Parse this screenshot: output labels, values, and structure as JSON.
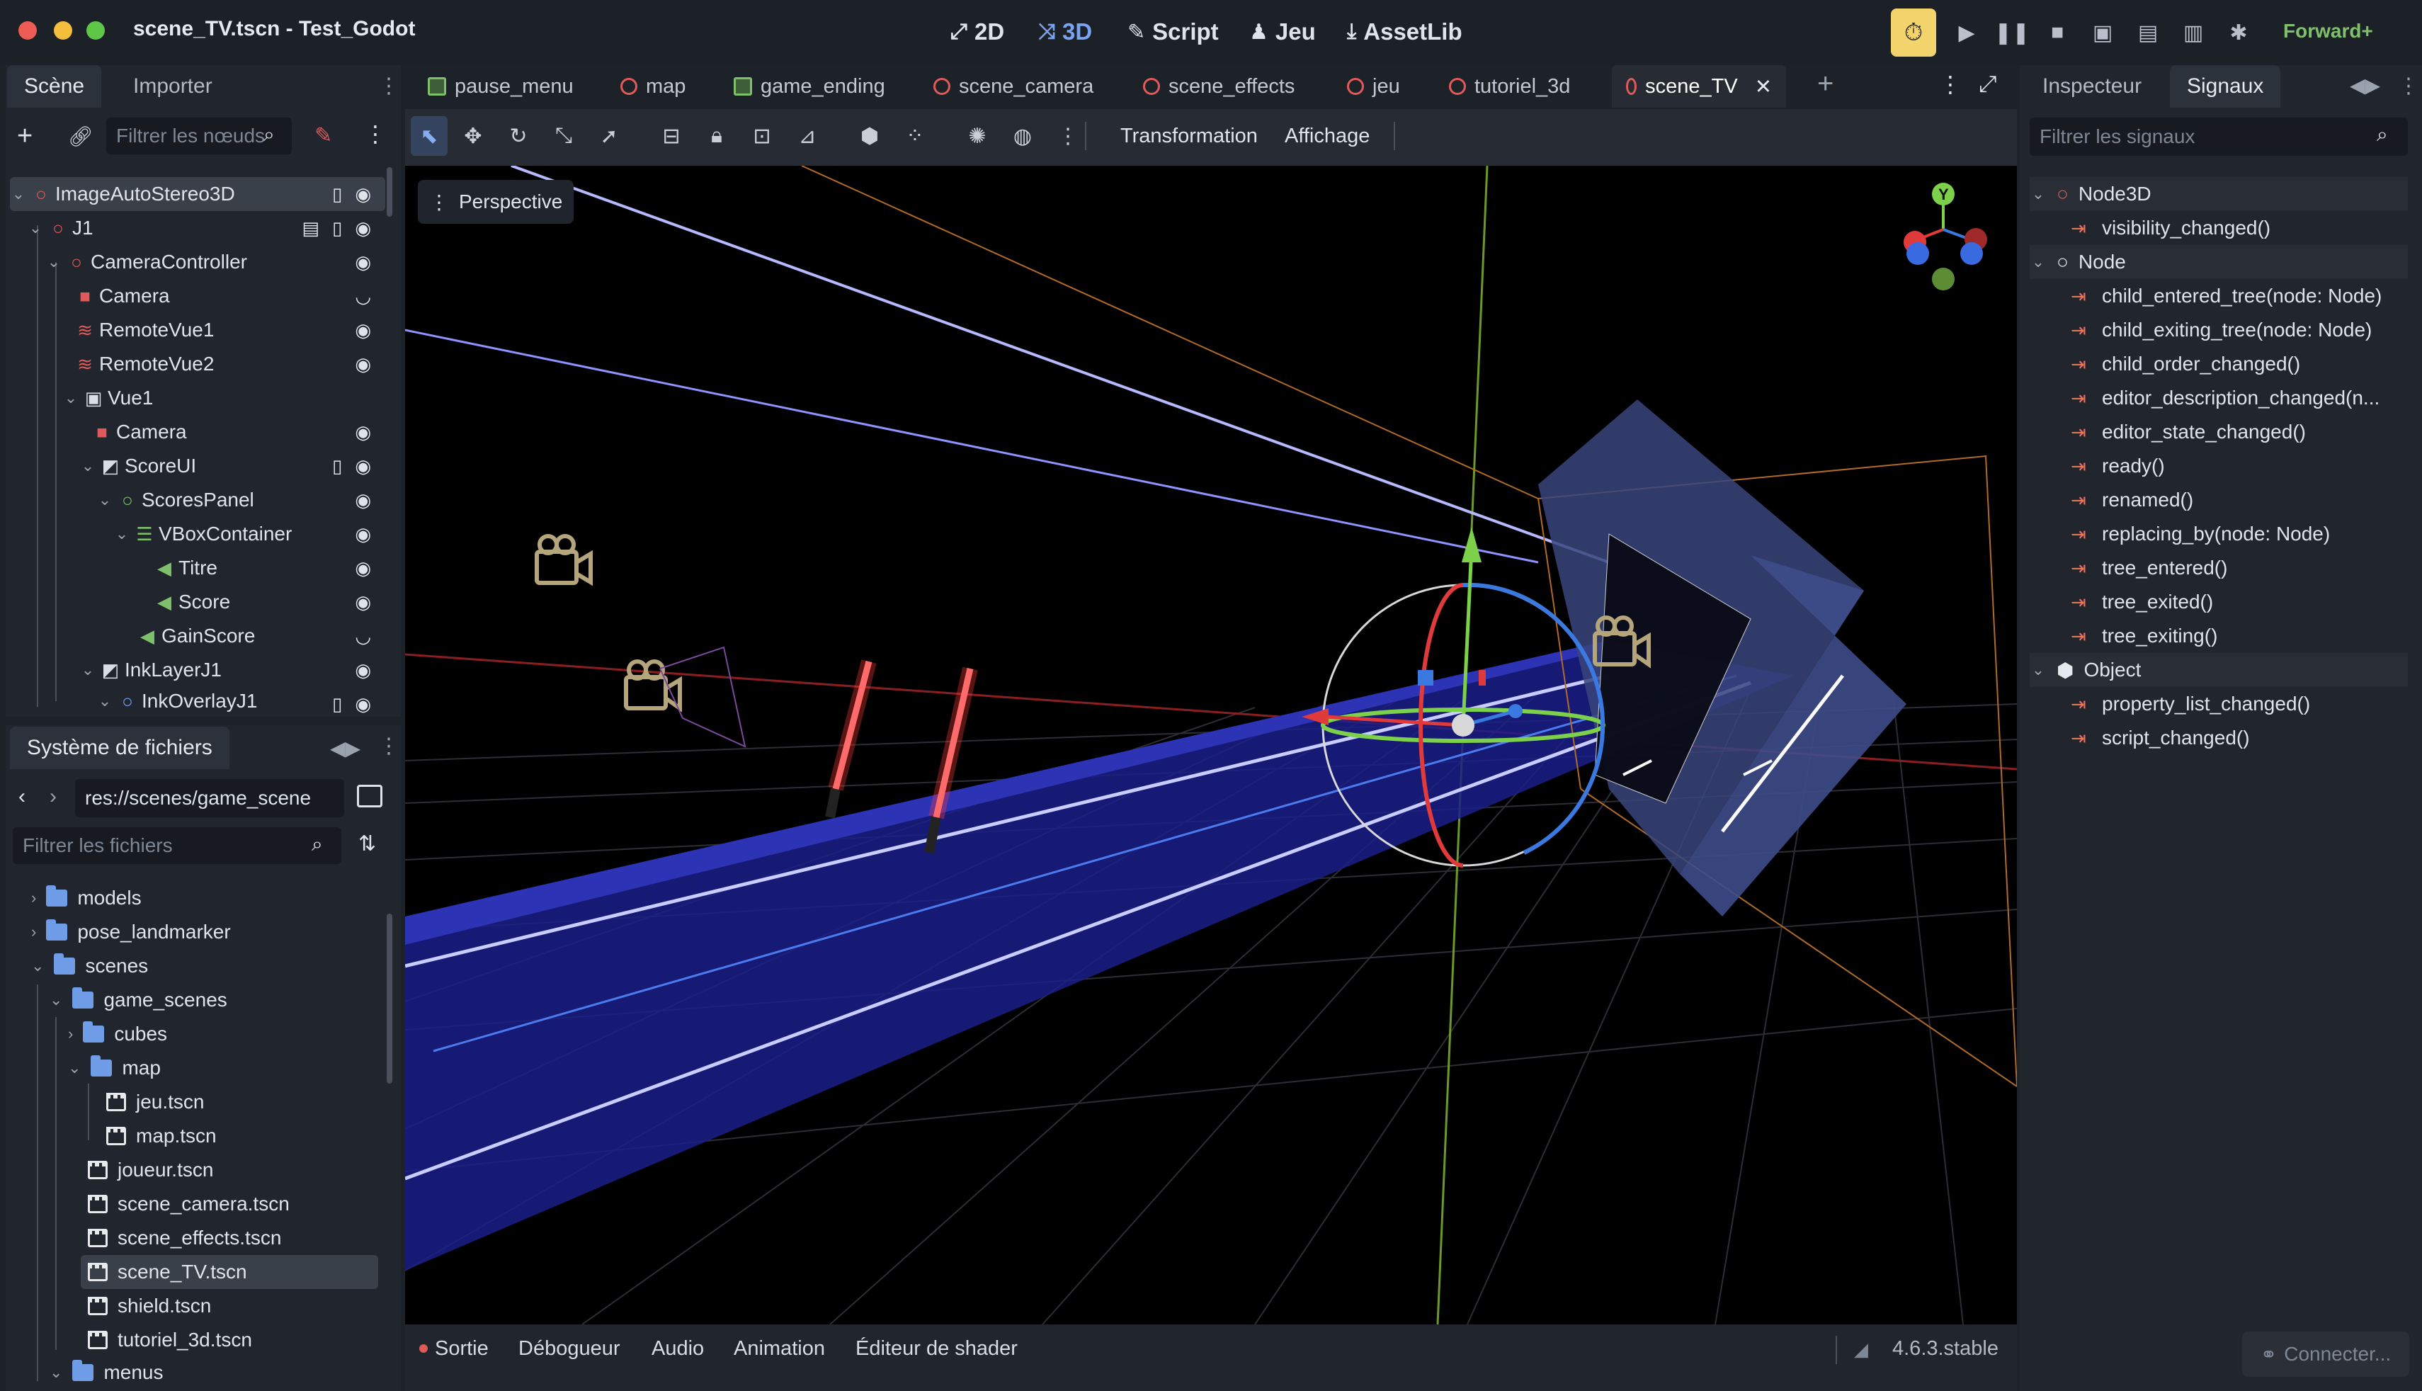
{
  "window": {
    "title": "scene_TV.tscn - Test_Godot"
  },
  "topbar": {
    "modes": [
      {
        "label": "2D",
        "icon": "2d-icon"
      },
      {
        "label": "3D",
        "icon": "3d-icon"
      },
      {
        "label": "Script",
        "icon": "script-icon"
      },
      {
        "label": "Jeu",
        "icon": "game-icon"
      },
      {
        "label": "AssetLib",
        "icon": "assetlib-icon"
      }
    ],
    "active_mode": "3D",
    "renderer": "Forward+"
  },
  "scene_dock": {
    "tabs": [
      "Scène",
      "Importer"
    ],
    "filter_placeholder": "Filtrer les nœuds",
    "nodes": [
      {
        "label": "ImageAutoStereo3D",
        "icon": "node3d-icon",
        "color": "#e05a5a",
        "selected": true
      },
      {
        "label": "J1",
        "icon": "node3d-icon",
        "color": "#e05a5a"
      },
      {
        "label": "CameraController",
        "icon": "node3d-icon",
        "color": "#e05a5a"
      },
      {
        "label": "Camera",
        "icon": "camera3d-icon",
        "color": "#e05a5a"
      },
      {
        "label": "RemoteVue1",
        "icon": "remote-icon",
        "color": "#e05a5a"
      },
      {
        "label": "RemoteVue2",
        "icon": "remote-icon",
        "color": "#e05a5a"
      },
      {
        "label": "Vue1",
        "icon": "subviewport-icon",
        "color": "#d8dde6"
      },
      {
        "label": "Camera",
        "icon": "camera3d-icon",
        "color": "#e05a5a"
      },
      {
        "label": "ScoreUI",
        "icon": "canvaslayer-icon",
        "color": "#d8dde6"
      },
      {
        "label": "ScoresPanel",
        "icon": "control-icon",
        "color": "#7fc06a"
      },
      {
        "label": "VBoxContainer",
        "icon": "vbox-icon",
        "color": "#7fc06a"
      },
      {
        "label": "Titre",
        "icon": "label-icon",
        "color": "#7fc06a"
      },
      {
        "label": "Score",
        "icon": "label-icon",
        "color": "#7fc06a"
      },
      {
        "label": "GainScore",
        "icon": "label-icon",
        "color": "#7fc06a"
      },
      {
        "label": "InkLayerJ1",
        "icon": "canvaslayer-icon",
        "color": "#d8dde6"
      },
      {
        "label": "InkOverlayJ1",
        "icon": "node2d-icon",
        "color": "#7aa3f0"
      }
    ]
  },
  "filesystem": {
    "title": "Système de fichiers",
    "path": "res://scenes/game_scene",
    "filter_placeholder": "Filtrer les fichiers",
    "items": [
      {
        "label": "models",
        "type": "folder"
      },
      {
        "label": "pose_landmarker",
        "type": "folder"
      },
      {
        "label": "scenes",
        "type": "folder"
      },
      {
        "label": "game_scenes",
        "type": "folder"
      },
      {
        "label": "cubes",
        "type": "folder"
      },
      {
        "label": "map",
        "type": "folder"
      },
      {
        "label": "jeu.tscn",
        "type": "scene"
      },
      {
        "label": "map.tscn",
        "type": "scene"
      },
      {
        "label": "joueur.tscn",
        "type": "scene"
      },
      {
        "label": "scene_camera.tscn",
        "type": "scene"
      },
      {
        "label": "scene_effects.tscn",
        "type": "scene"
      },
      {
        "label": "scene_TV.tscn",
        "type": "scene",
        "selected": true
      },
      {
        "label": "shield.tscn",
        "type": "scene"
      },
      {
        "label": "tutoriel_3d.tscn",
        "type": "scene"
      },
      {
        "label": "menus",
        "type": "folder"
      }
    ]
  },
  "editor_tabs": [
    {
      "label": "pause_menu",
      "icon": "control-icon"
    },
    {
      "label": "map",
      "icon": "node3d-icon"
    },
    {
      "label": "game_ending",
      "icon": "control-icon"
    },
    {
      "label": "scene_camera",
      "icon": "node3d-icon"
    },
    {
      "label": "scene_effects",
      "icon": "node3d-icon"
    },
    {
      "label": "jeu",
      "icon": "node3d-icon"
    },
    {
      "label": "tutoriel_3d",
      "icon": "node3d-icon"
    },
    {
      "label": "scene_TV",
      "icon": "node3d-icon",
      "selected": true
    }
  ],
  "toolbar": {
    "menus": [
      "Transformation",
      "Affichage"
    ]
  },
  "viewport": {
    "perspective_label": "Perspective",
    "gizmo_axis_label": "Y"
  },
  "bottom_panel": {
    "tabs": [
      "Sortie",
      "Débogueur",
      "Audio",
      "Animation",
      "Éditeur de shader"
    ],
    "version": "4.6.3.stable"
  },
  "inspector": {
    "tabs": [
      "Inspecteur",
      "Signaux"
    ],
    "active_tab": "Signaux",
    "filter_placeholder": "Filtrer les signaux",
    "groups": [
      {
        "class": "Node3D",
        "icon": "node3d-icon",
        "signals": [
          "visibility_changed()"
        ]
      },
      {
        "class": "Node",
        "icon": "node-icon",
        "signals": [
          "child_entered_tree(node: Node)",
          "child_exiting_tree(node: Node)",
          "child_order_changed()",
          "editor_description_changed(n...",
          "editor_state_changed()",
          "ready()",
          "renamed()",
          "replacing_by(node: Node)",
          "tree_entered()",
          "tree_exited()",
          "tree_exiting()"
        ]
      },
      {
        "class": "Object",
        "icon": "object-icon",
        "signals": [
          "property_list_changed()",
          "script_changed()"
        ]
      }
    ],
    "connect_label": "Connecter..."
  }
}
